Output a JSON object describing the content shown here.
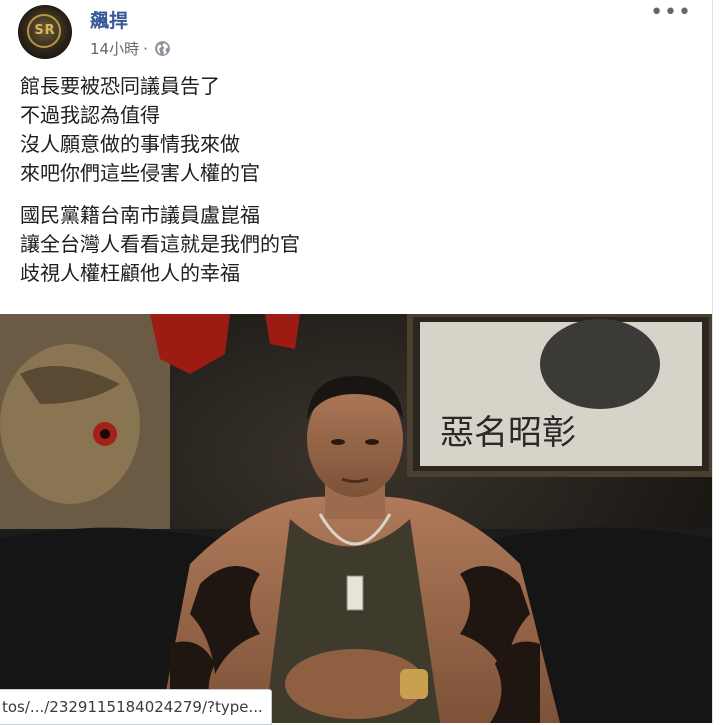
{
  "post": {
    "author": "飆捍",
    "time": "14小時",
    "separator": "·",
    "privacy_icon": "globe-icon",
    "more_icon": "more-options-icon",
    "more_glyph": "•••"
  },
  "avatar": {
    "letters": "SR"
  },
  "body": {
    "paragraphs": [
      [
        "館長要被恐同議員告了",
        "不過我認為值得",
        "沒人願意做的事情我來做",
        "來吧你們這些侵害人權的官"
      ],
      [
        "國民黨籍台南市議員盧崑福",
        "讓全台灣人看看這就是我們的官",
        "歧視人權枉顧他人的幸福"
      ]
    ]
  },
  "photo": {
    "poster_text": "惡名昭彰"
  },
  "status_bar": {
    "url": "tos/.../2329115184024279/?type..."
  },
  "colors": {
    "author_link": "#385898",
    "meta_text": "#616770",
    "body_text": "#1c1e21"
  }
}
